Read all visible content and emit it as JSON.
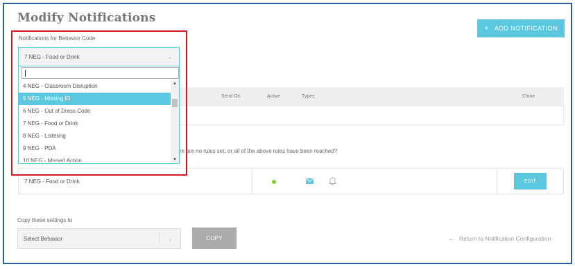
{
  "page": {
    "title": "Modify Notifications",
    "add_notification_label": "ADD NOTIFICATION",
    "add_icon": "plus-icon"
  },
  "behavior_select": {
    "label": "Notifications for Behavior Code",
    "value": "7 NEG - Food or Drink",
    "search_value": "",
    "options": [
      {
        "label": "4 NEG - Classroom Disruption",
        "selected": false
      },
      {
        "label": "5 NEG - Missing ID",
        "selected": true
      },
      {
        "label": "6 NEG - Out of Dress Code",
        "selected": false
      },
      {
        "label": "7 NEG - Food or Drink",
        "selected": false
      },
      {
        "label": "8 NEG - Loitering",
        "selected": false
      },
      {
        "label": "9 NEG - PDA",
        "selected": false
      },
      {
        "label": "10 NEG - Missed Action",
        "selected": false
      }
    ]
  },
  "rules_table": {
    "columns": {
      "send_on": "Send On",
      "active": "Active",
      "types": "Types",
      "clone": "Clone"
    }
  },
  "fallback": {
    "hint": "re are no rules set, or all of the above rules have been reached?",
    "row": {
      "behavior": "7 NEG - Food or Drink",
      "active": true,
      "types": [
        "email-icon",
        "bell-icon"
      ],
      "edit_label": "EDIT"
    }
  },
  "copy": {
    "label": "Copy these settings to",
    "select_value": "Select Behavior",
    "button_label": "COPY"
  },
  "return_link": {
    "label": "Return to Notification Configuration",
    "icon": "arrow-left-icon"
  },
  "colors": {
    "accent": "#5bc8df",
    "frame": "#2a5c9c",
    "highlight_box": "#d4171c",
    "active_dot": "#7ed321",
    "disabled_button": "#ababab"
  }
}
